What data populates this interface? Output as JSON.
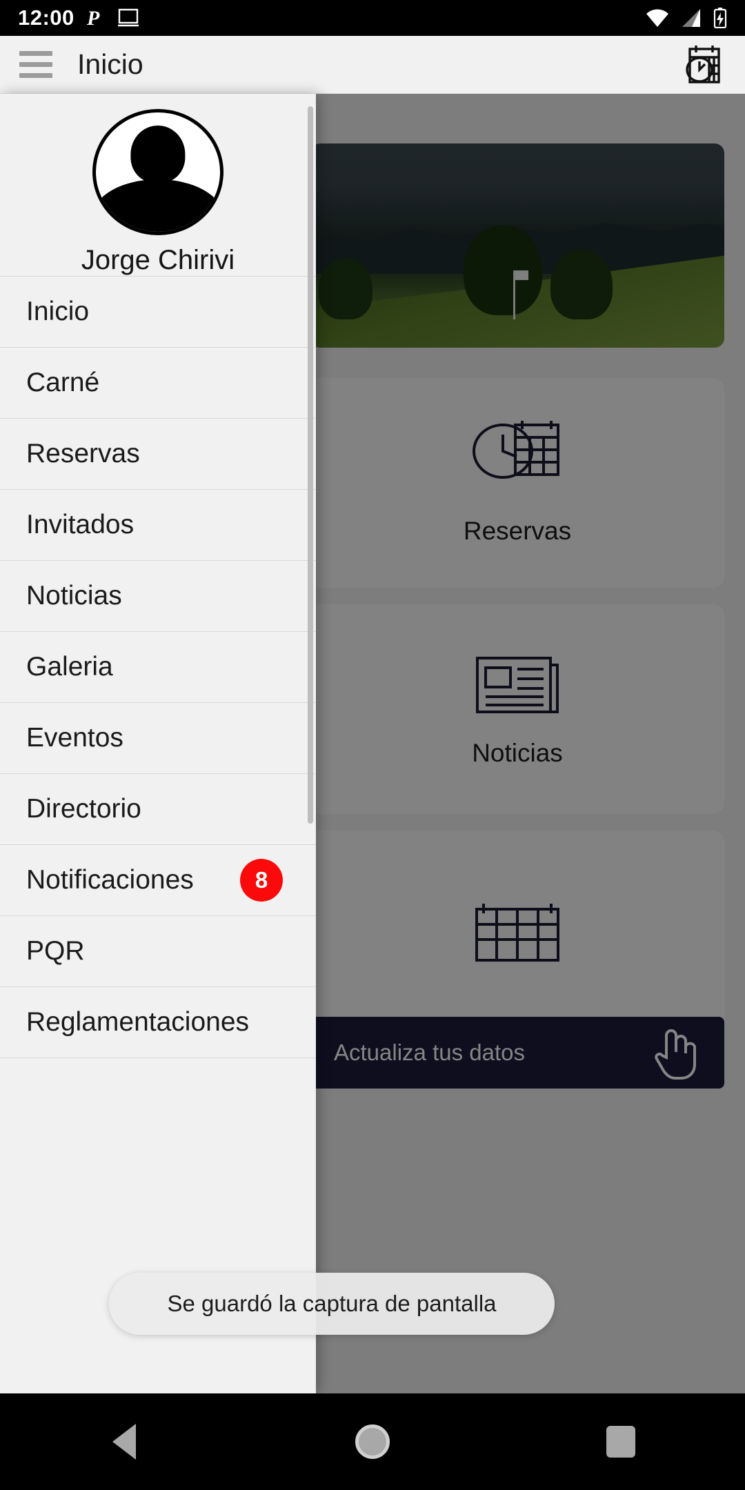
{
  "status_bar": {
    "time": "12:00",
    "icons": [
      "p-app-icon",
      "cast-screen-icon",
      "wifi-icon",
      "cellular-signal-icon",
      "battery-charging-icon"
    ]
  },
  "app_bar": {
    "menu_icon": "hamburger-menu-icon",
    "title": "Inicio",
    "action_icon": "calendar-clock-icon"
  },
  "drawer": {
    "avatar_icon": "user-avatar-placeholder",
    "username": "Jorge Chirivi",
    "items": [
      {
        "label": "Inicio",
        "badge": ""
      },
      {
        "label": "Carné",
        "badge": ""
      },
      {
        "label": "Reservas",
        "badge": ""
      },
      {
        "label": "Invitados",
        "badge": ""
      },
      {
        "label": "Noticias",
        "badge": ""
      },
      {
        "label": "Galeria",
        "badge": ""
      },
      {
        "label": "Eventos",
        "badge": ""
      },
      {
        "label": "Directorio",
        "badge": ""
      },
      {
        "label": "Notificaciones",
        "badge": "8"
      },
      {
        "label": "PQR",
        "badge": ""
      },
      {
        "label": "Reglamentaciones",
        "badge": ""
      }
    ]
  },
  "background": {
    "hero_alt": "golf-course-landscape-photo",
    "cards": [
      {
        "label": "Reservas",
        "icon": "clock-calendar-icon"
      },
      {
        "label": "Noticias",
        "icon": "newspaper-icon"
      },
      {
        "label": "",
        "icon": "grid-table-icon"
      }
    ],
    "banner": {
      "text": "Actualiza tus datos",
      "icon": "pointing-hand-icon"
    }
  },
  "toast": {
    "message": "Se guardó la captura de pantalla"
  },
  "nav_bar": {
    "back": "back-triangle-icon",
    "home": "home-circle-icon",
    "recents": "recents-square-icon"
  },
  "colors": {
    "badge_red": "#fa0a0a",
    "drawer_bg": "#f1f1f1",
    "banner_navy": "#1c1c3c",
    "status_bar": "#000000"
  }
}
